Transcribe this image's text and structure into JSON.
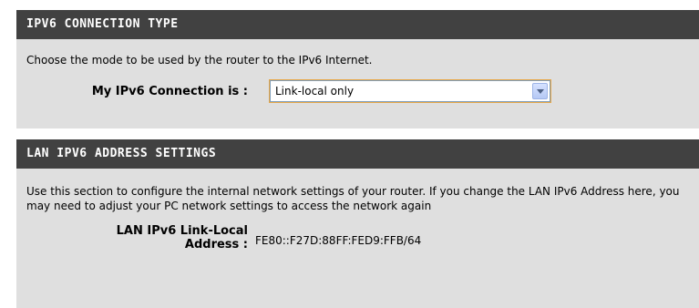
{
  "connection_type": {
    "header": "IPV6 CONNECTION TYPE",
    "description": "Choose the mode to be used by the router to the IPv6 Internet.",
    "label": "My IPv6 Connection is :",
    "selected_value": "Link-local only"
  },
  "lan_settings": {
    "header": "LAN IPV6 ADDRESS SETTINGS",
    "description": "Use this section to configure the internal network settings of your router. If you change the LAN IPv6 Address here, you may need to adjust your PC network settings to access the network again",
    "link_local_label_line1": "LAN IPv6 Link-Local",
    "link_local_label_line2": "Address :",
    "link_local_value": "FE80::F27D:88FF:FED9:FFB/64"
  },
  "colors": {
    "header_bg": "#414141",
    "panel_bg": "#dfdfdf",
    "select_focus": "#e8a848"
  }
}
